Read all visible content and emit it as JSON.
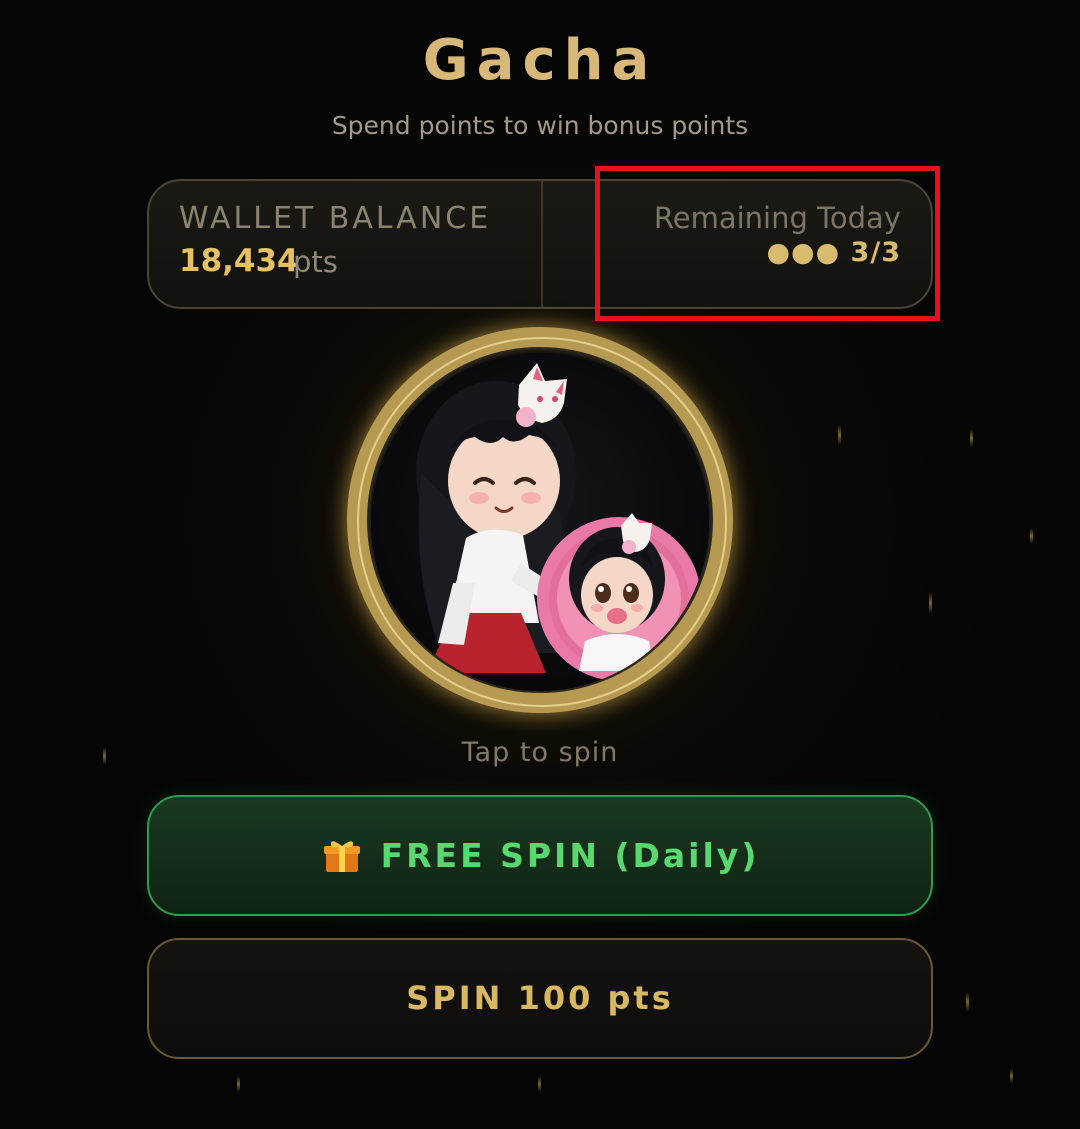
{
  "header": {
    "title": "Gacha",
    "subtitle": "Spend points to win bonus points"
  },
  "stats": {
    "wallet_label": "WALLET BALANCE",
    "wallet_value": "18,434",
    "wallet_unit": "pts",
    "remaining_label": "Remaining Today",
    "remaining_value": "●●● 3/3",
    "remaining_used": 3,
    "remaining_total": 3
  },
  "wheel": {
    "hint": "Tap to spin",
    "icon": "gacha-wheel-character-art"
  },
  "actions": {
    "free_spin_label": "FREE SPIN (Daily)",
    "free_spin_icon": "gift-icon",
    "paid_spin_label": "SPIN 100 pts"
  },
  "colors": {
    "background": "#050505",
    "gold": "#d7b878",
    "green": "#59d86f",
    "highlight": "#e5111d"
  }
}
